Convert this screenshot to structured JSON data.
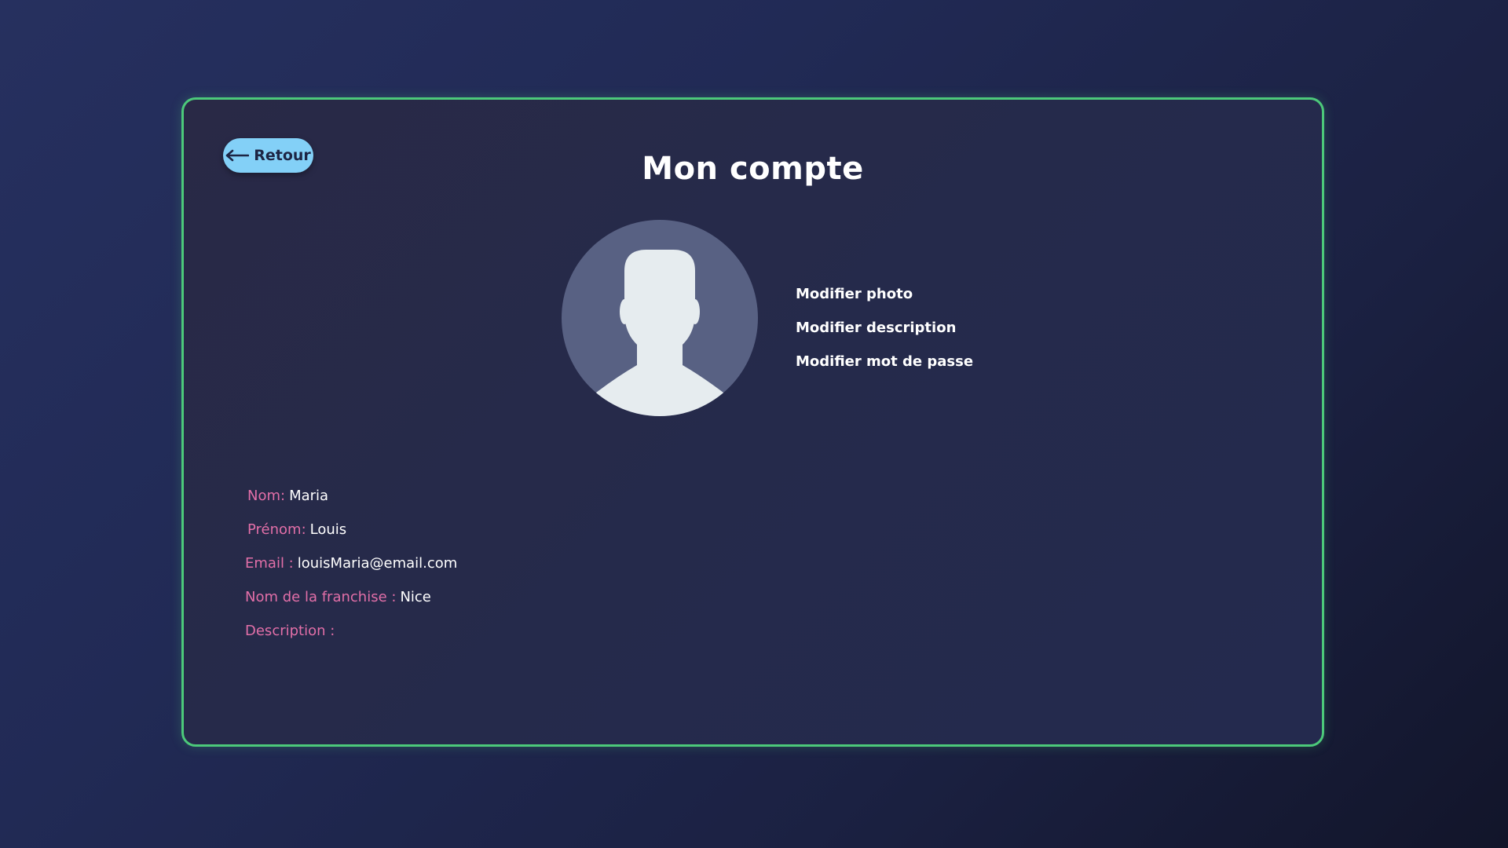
{
  "header": {
    "back_label": "Retour",
    "back_icon": "arrow-left-icon",
    "title": "Mon compte"
  },
  "avatar": {
    "icon": "user-silhouette-icon",
    "background_color": "#586183",
    "figure_color": "#e6ecef"
  },
  "actions": [
    "Modifier photo",
    "Modifier description",
    "Modifier mot de passe"
  ],
  "profile": {
    "nom_label": "Nom:",
    "nom_value": "Maria",
    "prenom_label": "Prénom:",
    "prenom_value": "Louis",
    "email_label": "Email :",
    "email_value": "louisMaria@email.com",
    "franchise_label": "Nom de la franchise :",
    "franchise_value": "Nice",
    "description_label": "Description :",
    "description_value": ""
  },
  "colors": {
    "card_border": "#4cc97a",
    "back_button": "#83d0f7",
    "label_pink": "#e26fa8",
    "text": "#ffffff"
  }
}
